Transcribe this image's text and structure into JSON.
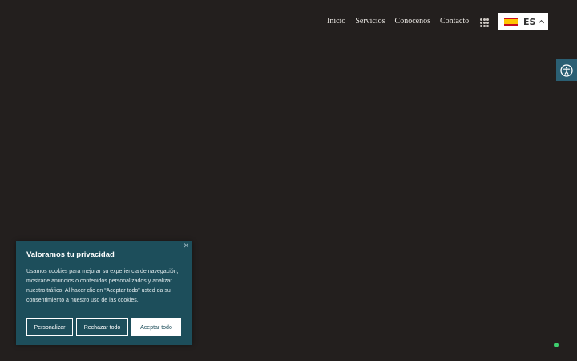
{
  "nav": {
    "items": [
      {
        "label": "Inicio",
        "active": true
      },
      {
        "label": "Servicios"
      },
      {
        "label": "Conócenos"
      },
      {
        "label": "Contacto"
      }
    ]
  },
  "language": {
    "code": "ES",
    "flag": "spain-flag-icon"
  },
  "cookie": {
    "title": "Valoramos tu privacidad",
    "text": "Usamos cookies para mejorar su experiencia de navegación, mostrarle anuncios o contenidos personalizados y analizar nuestro tráfico. Al hacer clic en “Aceptar todo” usted da su consentimiento a nuestro uso de las cookies.",
    "close_glyph": "✕",
    "buttons": {
      "customize": "Personalizar",
      "reject": "Rechazar todo",
      "accept": "Aceptar todo"
    }
  },
  "colors": {
    "background": "#231f1e",
    "cookie_bg": "#1d4e5b",
    "accessibility_bg": "#2b5f73",
    "status_dot": "#3ecf6e"
  }
}
